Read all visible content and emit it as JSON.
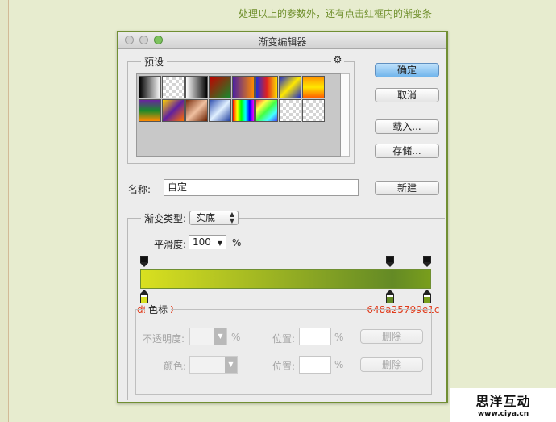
{
  "page": {
    "caption": "处理以上的参数外，还有点击红框内的渐变条"
  },
  "dialog": {
    "title": "渐变编辑器",
    "presets": {
      "label": "预设",
      "gear_icon": "gear-icon",
      "swatches": [
        {
          "name": "black-to-white",
          "bg": "linear-gradient(to right,#000,#fff)"
        },
        {
          "name": "white-to-transparent",
          "bg": "checker"
        },
        {
          "name": "black-to-white-2",
          "bg": "linear-gradient(to right,#fff,#000)"
        },
        {
          "name": "red-to-green",
          "bg": "linear-gradient(135deg,#c20000,#148a2b)"
        },
        {
          "name": "violet-to-orange",
          "bg": "linear-gradient(to right,#4a20a0,#ff8a00)"
        },
        {
          "name": "blue-red-yellow",
          "bg": "linear-gradient(to right,#1e2fd8,#e02020,#ffe000)"
        },
        {
          "name": "blue-yellow-blue",
          "bg": "linear-gradient(135deg,#1a2ad0,#ffe800,#1a2ad0)"
        },
        {
          "name": "orange-yellow-orange",
          "bg": "linear-gradient(to bottom,#ff9000,#ffe800,#ff6000)"
        },
        {
          "name": "violet-green-orange",
          "bg": "linear-gradient(to bottom,#6a22a0,#1a8a2a,#ff8a00)"
        },
        {
          "name": "yellow-violet-orange",
          "bg": "linear-gradient(135deg,#ffd000,#6020a0,#ff7000)"
        },
        {
          "name": "copper",
          "bg": "linear-gradient(135deg,#7a3010,#f0c0a0,#6a2000)"
        },
        {
          "name": "steel-blue",
          "bg": "linear-gradient(135deg,#3050b0,#e0f0ff,#2040a0)"
        },
        {
          "name": "spectrum",
          "bg": "linear-gradient(to right,#f00,#ff0,#0f0,#0ff,#00f,#f0f)"
        },
        {
          "name": "transparent-rainbow",
          "bg": "linear-gradient(135deg,#f44,#ff4,#4f4,#4ff,#44f)"
        },
        {
          "name": "transparent-stripes",
          "bg": "checker-green"
        },
        {
          "name": "neutral-density",
          "bg": "checker"
        }
      ]
    },
    "buttons": {
      "ok": "确定",
      "cancel": "取消",
      "load": "载入...",
      "save": "存储...",
      "new": "新建"
    },
    "name_label": "名称:",
    "name_value": "自定",
    "type_label": "渐变类型:",
    "type_value": "实底",
    "smoothness_label": "平滑度:",
    "smoothness_value": "100",
    "smoothness_unit": "%",
    "gradient": {
      "colors": [
        "#d9e020",
        "#648a25",
        "#799e1c"
      ],
      "stops": [
        {
          "color": "#d9e020",
          "label": "d9e020",
          "location": 0
        },
        {
          "color": "#648a25",
          "label": "648a25",
          "location": 87
        },
        {
          "color": "#799e1c",
          "label": "799e1c",
          "location": 100
        }
      ],
      "opacity_stops": [
        0,
        87,
        100
      ]
    },
    "color_stops": {
      "label": "色标",
      "opacity_label": "不透明度:",
      "opacity_unit": "%",
      "location_label_1": "位置:",
      "location_unit_1": "%",
      "delete_label_1": "删除",
      "color_label": "颜色:",
      "location_label_2": "位置:",
      "location_unit_2": "%",
      "delete_label_2": "删除"
    }
  },
  "watermark": {
    "title": "思洋互动",
    "url": "www.ciya.cn"
  }
}
